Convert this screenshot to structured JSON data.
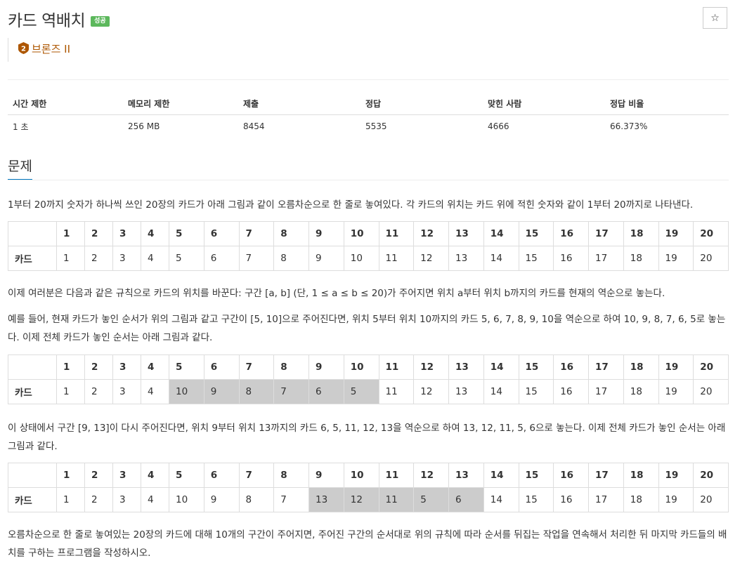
{
  "problem": {
    "title": "카드 역배치",
    "status_badge": "성공",
    "tier": {
      "number": "2",
      "label": "브론즈 II",
      "color": "#ad5600"
    },
    "star_icon": "☆"
  },
  "info": {
    "headers": [
      "시간 제한",
      "메모리 제한",
      "제출",
      "정답",
      "맞힌 사람",
      "정답 비율"
    ],
    "values": [
      "1 초",
      "256 MB",
      "8454",
      "5535",
      "4666",
      "66.373%"
    ]
  },
  "section": {
    "title": "문제"
  },
  "paragraphs": {
    "p1": "1부터 20까지 숫자가 하나씩 쓰인 20장의 카드가 아래 그림과 같이 오름차순으로 한 줄로 놓여있다. 각 카드의 위치는 카드 위에 적힌 숫자와 같이 1부터 20까지로 나타낸다.",
    "p2": "이제 여러분은 다음과 같은 규칙으로 카드의 위치를 바꾼다: 구간 [a, b] (단, 1 ≤ a ≤ b ≤ 20)가 주어지면 위치 a부터 위치 b까지의 카드를 현재의 역순으로 놓는다.",
    "p3": "예를 들어, 현재 카드가 놓인 순서가 위의 그림과 같고 구간이 [5, 10]으로 주어진다면, 위치 5부터 위치 10까지의 카드 5, 6, 7, 8, 9, 10을 역순으로 하여 10, 9, 8, 7, 6, 5로 놓는다. 이제 전체 카드가 놓인 순서는 아래 그림과 같다.",
    "p4": "이 상태에서 구간 [9, 13]이 다시 주어진다면, 위치 9부터 위치 13까지의 카드 6, 5, 11, 12, 13을 역순으로 하여 13, 12, 11, 5, 6으로 놓는다. 이제 전체 카드가 놓인 순서는 아래 그림과 같다.",
    "p5": "오름차순으로 한 줄로 놓여있는 20장의 카드에 대해 10개의 구간이 주어지면, 주어진 구간의 순서대로 위의 규칙에 따라 순서를 뒤집는 작업을 연속해서 처리한 뒤 마지막 카드들의 배치를 구하는 프로그램을 작성하시오."
  },
  "tables": {
    "row_label": "카드",
    "positions": [
      "1",
      "2",
      "3",
      "4",
      "5",
      "6",
      "7",
      "8",
      "9",
      "10",
      "11",
      "12",
      "13",
      "14",
      "15",
      "16",
      "17",
      "18",
      "19",
      "20"
    ],
    "t1": {
      "cards": [
        "1",
        "2",
        "3",
        "4",
        "5",
        "6",
        "7",
        "8",
        "9",
        "10",
        "11",
        "12",
        "13",
        "14",
        "15",
        "16",
        "17",
        "18",
        "19",
        "20"
      ],
      "highlight": []
    },
    "t2": {
      "cards": [
        "1",
        "2",
        "3",
        "4",
        "10",
        "9",
        "8",
        "7",
        "6",
        "5",
        "11",
        "12",
        "13",
        "14",
        "15",
        "16",
        "17",
        "18",
        "19",
        "20"
      ],
      "highlight": [
        5,
        6,
        7,
        8,
        9,
        10
      ]
    },
    "t3": {
      "cards": [
        "1",
        "2",
        "3",
        "4",
        "10",
        "9",
        "8",
        "7",
        "13",
        "12",
        "11",
        "5",
        "6",
        "14",
        "15",
        "16",
        "17",
        "18",
        "19",
        "20"
      ],
      "highlight": [
        9,
        10,
        11,
        12,
        13
      ]
    }
  },
  "colors": {
    "highlight": "#cccccc",
    "success": "#5cb85c",
    "accent": "#0076c0"
  }
}
